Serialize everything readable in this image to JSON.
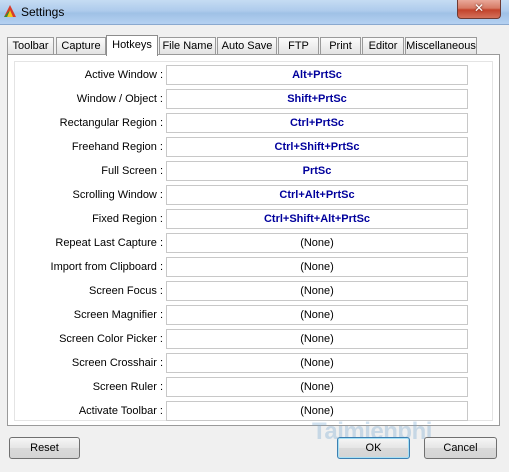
{
  "window": {
    "title": "Settings",
    "close_label": "✕"
  },
  "tabs": [
    {
      "label": "Toolbar"
    },
    {
      "label": "Capture"
    },
    {
      "label": "Hotkeys"
    },
    {
      "label": "File Name"
    },
    {
      "label": "Auto Save"
    },
    {
      "label": "FTP"
    },
    {
      "label": "Print"
    },
    {
      "label": "Editor"
    },
    {
      "label": "Miscellaneous"
    }
  ],
  "active_tab": "Hotkeys",
  "hotkeys": [
    {
      "label": "Active Window :",
      "value": "Alt+PrtSc"
    },
    {
      "label": "Window / Object :",
      "value": "Shift+PrtSc"
    },
    {
      "label": "Rectangular Region :",
      "value": "Ctrl+PrtSc"
    },
    {
      "label": "Freehand Region :",
      "value": "Ctrl+Shift+PrtSc"
    },
    {
      "label": "Full Screen :",
      "value": "PrtSc"
    },
    {
      "label": "Scrolling Window :",
      "value": "Ctrl+Alt+PrtSc"
    },
    {
      "label": "Fixed Region :",
      "value": "Ctrl+Shift+Alt+PrtSc"
    },
    {
      "label": "Repeat Last Capture :",
      "value": "(None)"
    },
    {
      "label": "Import from Clipboard :",
      "value": "(None)"
    },
    {
      "label": "Screen Focus :",
      "value": "(None)"
    },
    {
      "label": "Screen Magnifier :",
      "value": "(None)"
    },
    {
      "label": "Screen Color Picker :",
      "value": "(None)"
    },
    {
      "label": "Screen Crosshair :",
      "value": "(None)"
    },
    {
      "label": "Screen Ruler :",
      "value": "(None)"
    },
    {
      "label": "Activate Toolbar :",
      "value": "(None)"
    }
  ],
  "buttons": {
    "reset": "Reset",
    "ok": "OK",
    "cancel": "Cancel"
  },
  "watermark": "Taimienphi",
  "colors": {
    "hotkey_text": "#00009c",
    "titlebar": "#aecbec",
    "close": "#c3422b"
  }
}
